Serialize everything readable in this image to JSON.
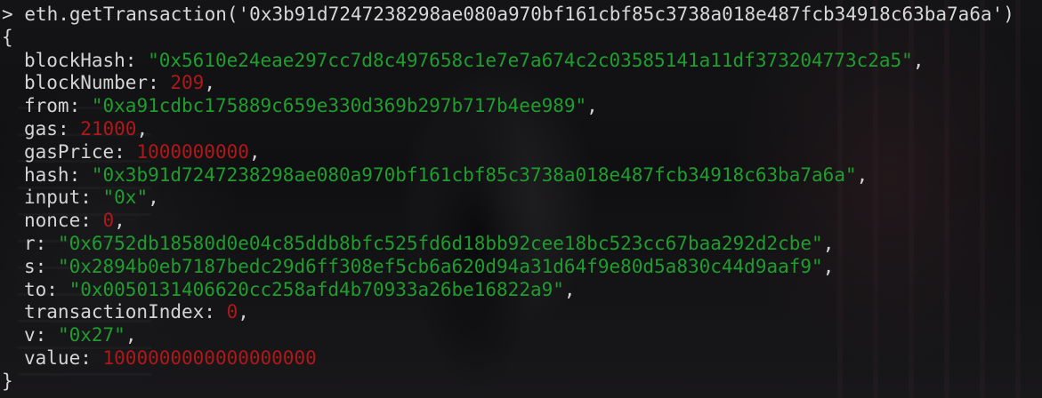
{
  "console": {
    "prompt_symbol": ">",
    "command": "eth.getTransaction('0x3b91d7247238298ae080a970bf161cbf85c3738a018e487fcb34918c63ba7a6a')",
    "open_brace": "{",
    "close_brace": "}",
    "fields": [
      {
        "key": "blockHash",
        "value": "\"0x5610e24eae297cc7d8c497658c1e7e7a674c2c03585141a11df373204773c2a5\"",
        "type": "string"
      },
      {
        "key": "blockNumber",
        "value": "209",
        "type": "number"
      },
      {
        "key": "from",
        "value": "\"0xa91cdbc175889c659e330d369b297b717b4ee989\"",
        "type": "string"
      },
      {
        "key": "gas",
        "value": "21000",
        "type": "number"
      },
      {
        "key": "gasPrice",
        "value": "1000000000",
        "type": "number"
      },
      {
        "key": "hash",
        "value": "\"0x3b91d7247238298ae080a970bf161cbf85c3738a018e487fcb34918c63ba7a6a\"",
        "type": "string"
      },
      {
        "key": "input",
        "value": "\"0x\"",
        "type": "string"
      },
      {
        "key": "nonce",
        "value": "0",
        "type": "number"
      },
      {
        "key": "r",
        "value": "\"0x6752db18580d0e04c85ddb8bfc525fd6d18bb92cee18bc523cc67baa292d2cbe\"",
        "type": "string"
      },
      {
        "key": "s",
        "value": "\"0x2894b0eb7187bedc29d6ff308ef5cb6a620d94a31d64f9e80d5a830c44d9aaf9\"",
        "type": "string"
      },
      {
        "key": "to",
        "value": "\"0x0050131406620cc258afd4b70933a26be16822a9\"",
        "type": "string"
      },
      {
        "key": "transactionIndex",
        "value": "0",
        "type": "number"
      },
      {
        "key": "v",
        "value": "\"0x27\"",
        "type": "string"
      },
      {
        "key": "value",
        "value": "1000000000000000000",
        "type": "number"
      }
    ]
  },
  "colors": {
    "string": "#1f9e2e",
    "number": "#b01818",
    "text": "#d4d4d4"
  }
}
